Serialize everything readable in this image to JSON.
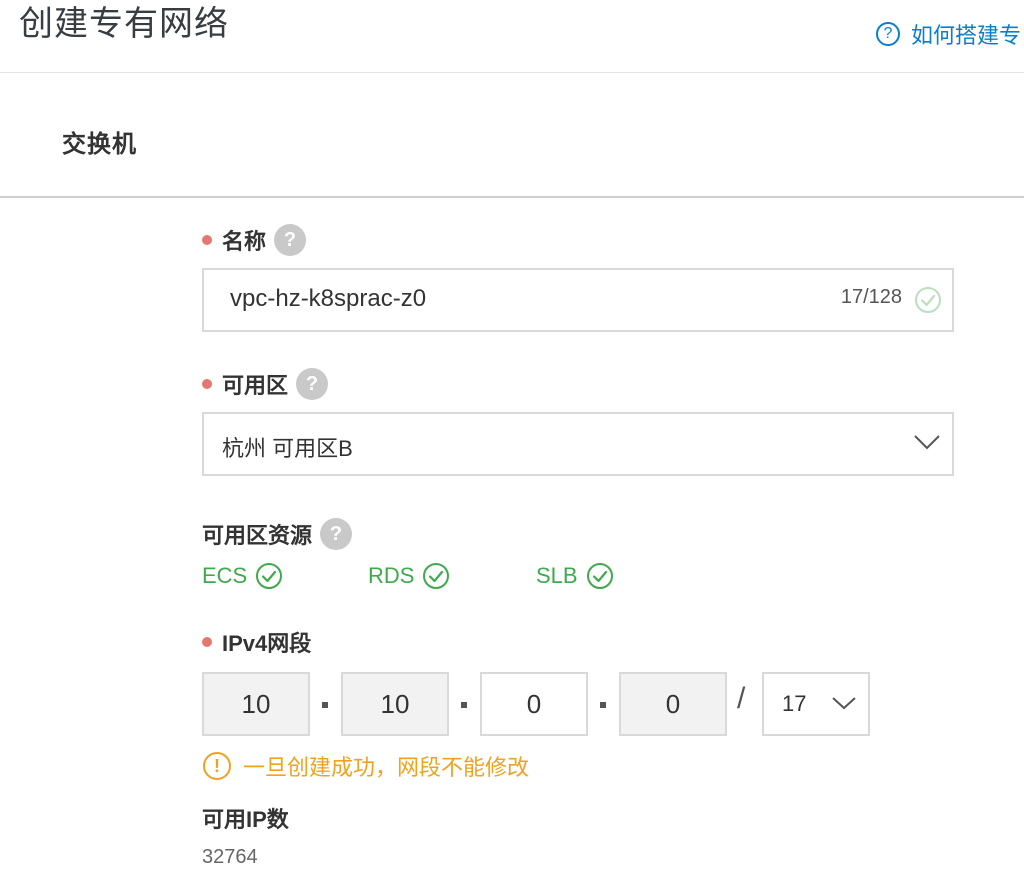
{
  "header": {
    "title": "创建专有网络",
    "help_link": "如何搭建专"
  },
  "section": {
    "title": "交换机"
  },
  "name_field": {
    "label": "名称",
    "value": "vpc-hz-k8sprac-z0",
    "counter": "17/128"
  },
  "zone_field": {
    "label": "可用区",
    "value": "杭州 可用区B"
  },
  "zone_resources": {
    "label": "可用区资源",
    "items": [
      {
        "label": "ECS"
      },
      {
        "label": "RDS"
      },
      {
        "label": "SLB"
      }
    ]
  },
  "ipv4_field": {
    "label": "IPv4网段",
    "octets": [
      "10",
      "10",
      "0",
      "0"
    ],
    "separator": "/",
    "mask": "17",
    "warning": "一旦创建成功，网段不能修改"
  },
  "available_ips": {
    "label": "可用IP数",
    "value": "32764"
  },
  "colors": {
    "required_dot": "#e5786e",
    "link": "#0a7fc8",
    "success": "#3eaa4c",
    "warning": "#f0a21f"
  },
  "icons": {
    "help": "question-circle-icon",
    "tooltip": "question-mark-icon",
    "valid": "check-circle-icon",
    "dropdown": "chevron-down-icon",
    "warning": "exclamation-circle-icon"
  }
}
